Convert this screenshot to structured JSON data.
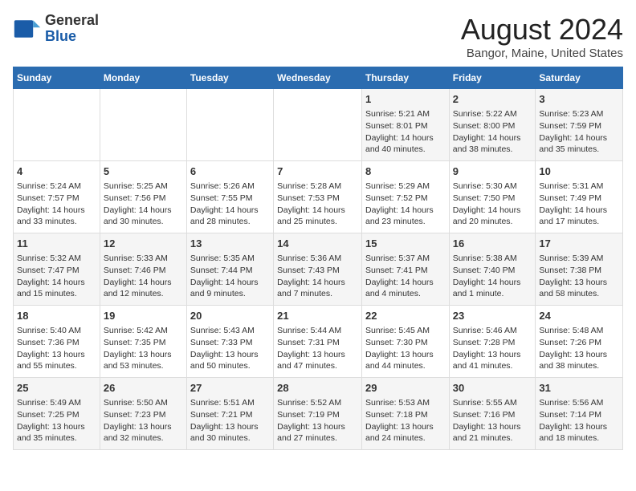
{
  "logo": {
    "general": "General",
    "blue": "Blue"
  },
  "title": "August 2024",
  "subtitle": "Bangor, Maine, United States",
  "days_of_week": [
    "Sunday",
    "Monday",
    "Tuesday",
    "Wednesday",
    "Thursday",
    "Friday",
    "Saturday"
  ],
  "weeks": [
    [
      {
        "day": "",
        "content": ""
      },
      {
        "day": "",
        "content": ""
      },
      {
        "day": "",
        "content": ""
      },
      {
        "day": "",
        "content": ""
      },
      {
        "day": "1",
        "content": "Sunrise: 5:21 AM\nSunset: 8:01 PM\nDaylight: 14 hours\nand 40 minutes."
      },
      {
        "day": "2",
        "content": "Sunrise: 5:22 AM\nSunset: 8:00 PM\nDaylight: 14 hours\nand 38 minutes."
      },
      {
        "day": "3",
        "content": "Sunrise: 5:23 AM\nSunset: 7:59 PM\nDaylight: 14 hours\nand 35 minutes."
      }
    ],
    [
      {
        "day": "4",
        "content": "Sunrise: 5:24 AM\nSunset: 7:57 PM\nDaylight: 14 hours\nand 33 minutes."
      },
      {
        "day": "5",
        "content": "Sunrise: 5:25 AM\nSunset: 7:56 PM\nDaylight: 14 hours\nand 30 minutes."
      },
      {
        "day": "6",
        "content": "Sunrise: 5:26 AM\nSunset: 7:55 PM\nDaylight: 14 hours\nand 28 minutes."
      },
      {
        "day": "7",
        "content": "Sunrise: 5:28 AM\nSunset: 7:53 PM\nDaylight: 14 hours\nand 25 minutes."
      },
      {
        "day": "8",
        "content": "Sunrise: 5:29 AM\nSunset: 7:52 PM\nDaylight: 14 hours\nand 23 minutes."
      },
      {
        "day": "9",
        "content": "Sunrise: 5:30 AM\nSunset: 7:50 PM\nDaylight: 14 hours\nand 20 minutes."
      },
      {
        "day": "10",
        "content": "Sunrise: 5:31 AM\nSunset: 7:49 PM\nDaylight: 14 hours\nand 17 minutes."
      }
    ],
    [
      {
        "day": "11",
        "content": "Sunrise: 5:32 AM\nSunset: 7:47 PM\nDaylight: 14 hours\nand 15 minutes."
      },
      {
        "day": "12",
        "content": "Sunrise: 5:33 AM\nSunset: 7:46 PM\nDaylight: 14 hours\nand 12 minutes."
      },
      {
        "day": "13",
        "content": "Sunrise: 5:35 AM\nSunset: 7:44 PM\nDaylight: 14 hours\nand 9 minutes."
      },
      {
        "day": "14",
        "content": "Sunrise: 5:36 AM\nSunset: 7:43 PM\nDaylight: 14 hours\nand 7 minutes."
      },
      {
        "day": "15",
        "content": "Sunrise: 5:37 AM\nSunset: 7:41 PM\nDaylight: 14 hours\nand 4 minutes."
      },
      {
        "day": "16",
        "content": "Sunrise: 5:38 AM\nSunset: 7:40 PM\nDaylight: 14 hours\nand 1 minute."
      },
      {
        "day": "17",
        "content": "Sunrise: 5:39 AM\nSunset: 7:38 PM\nDaylight: 13 hours\nand 58 minutes."
      }
    ],
    [
      {
        "day": "18",
        "content": "Sunrise: 5:40 AM\nSunset: 7:36 PM\nDaylight: 13 hours\nand 55 minutes."
      },
      {
        "day": "19",
        "content": "Sunrise: 5:42 AM\nSunset: 7:35 PM\nDaylight: 13 hours\nand 53 minutes."
      },
      {
        "day": "20",
        "content": "Sunrise: 5:43 AM\nSunset: 7:33 PM\nDaylight: 13 hours\nand 50 minutes."
      },
      {
        "day": "21",
        "content": "Sunrise: 5:44 AM\nSunset: 7:31 PM\nDaylight: 13 hours\nand 47 minutes."
      },
      {
        "day": "22",
        "content": "Sunrise: 5:45 AM\nSunset: 7:30 PM\nDaylight: 13 hours\nand 44 minutes."
      },
      {
        "day": "23",
        "content": "Sunrise: 5:46 AM\nSunset: 7:28 PM\nDaylight: 13 hours\nand 41 minutes."
      },
      {
        "day": "24",
        "content": "Sunrise: 5:48 AM\nSunset: 7:26 PM\nDaylight: 13 hours\nand 38 minutes."
      }
    ],
    [
      {
        "day": "25",
        "content": "Sunrise: 5:49 AM\nSunset: 7:25 PM\nDaylight: 13 hours\nand 35 minutes."
      },
      {
        "day": "26",
        "content": "Sunrise: 5:50 AM\nSunset: 7:23 PM\nDaylight: 13 hours\nand 32 minutes."
      },
      {
        "day": "27",
        "content": "Sunrise: 5:51 AM\nSunset: 7:21 PM\nDaylight: 13 hours\nand 30 minutes."
      },
      {
        "day": "28",
        "content": "Sunrise: 5:52 AM\nSunset: 7:19 PM\nDaylight: 13 hours\nand 27 minutes."
      },
      {
        "day": "29",
        "content": "Sunrise: 5:53 AM\nSunset: 7:18 PM\nDaylight: 13 hours\nand 24 minutes."
      },
      {
        "day": "30",
        "content": "Sunrise: 5:55 AM\nSunset: 7:16 PM\nDaylight: 13 hours\nand 21 minutes."
      },
      {
        "day": "31",
        "content": "Sunrise: 5:56 AM\nSunset: 7:14 PM\nDaylight: 13 hours\nand 18 minutes."
      }
    ]
  ]
}
